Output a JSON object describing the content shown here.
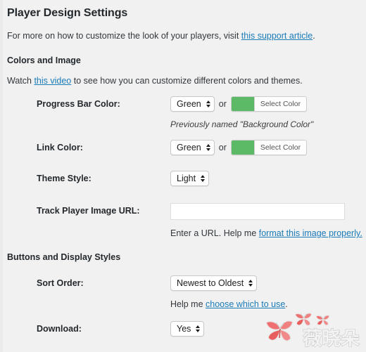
{
  "page": {
    "title": "Player Design Settings",
    "intro_before": "For more on how to customize the look of your players, visit ",
    "intro_link": "this support article",
    "intro_after": "."
  },
  "sections": [
    {
      "heading": "Colors and Image",
      "description_before": "Watch ",
      "description_link": "this video",
      "description_after": " to see how you can customize different colors and themes."
    },
    {
      "heading": "Buttons and Display Styles"
    }
  ],
  "fields": {
    "progress_bar_color": {
      "label": "Progress Bar Color:",
      "select_value": "Green",
      "or_text": "or",
      "swatch_color": "#5cba66",
      "picker_label": "Select Color",
      "note": "Previously named \"Background Color\""
    },
    "link_color": {
      "label": "Link Color:",
      "select_value": "Green",
      "or_text": "or",
      "swatch_color": "#5cba66",
      "picker_label": "Select Color"
    },
    "theme_style": {
      "label": "Theme Style:",
      "select_value": "Light"
    },
    "track_player_image_url": {
      "label": "Track Player Image URL:",
      "value": "",
      "placeholder": "",
      "help_before": "Enter a URL. Help me ",
      "help_link": "format this image properly.",
      "help_after": ""
    },
    "sort_order": {
      "label": "Sort Order:",
      "select_value": "Newest to Oldest",
      "help_before": "Help me ",
      "help_link": "choose which to use",
      "help_after": "."
    },
    "download": {
      "label": "Download:",
      "select_value": "Yes"
    }
  },
  "watermark": {
    "text": "薇晓朵",
    "icon": "butterfly-icon"
  },
  "colors": {
    "background": "#f1f1f1",
    "link": "#1a7bb9",
    "text": "#23282d",
    "accent_green": "#5cba66"
  }
}
